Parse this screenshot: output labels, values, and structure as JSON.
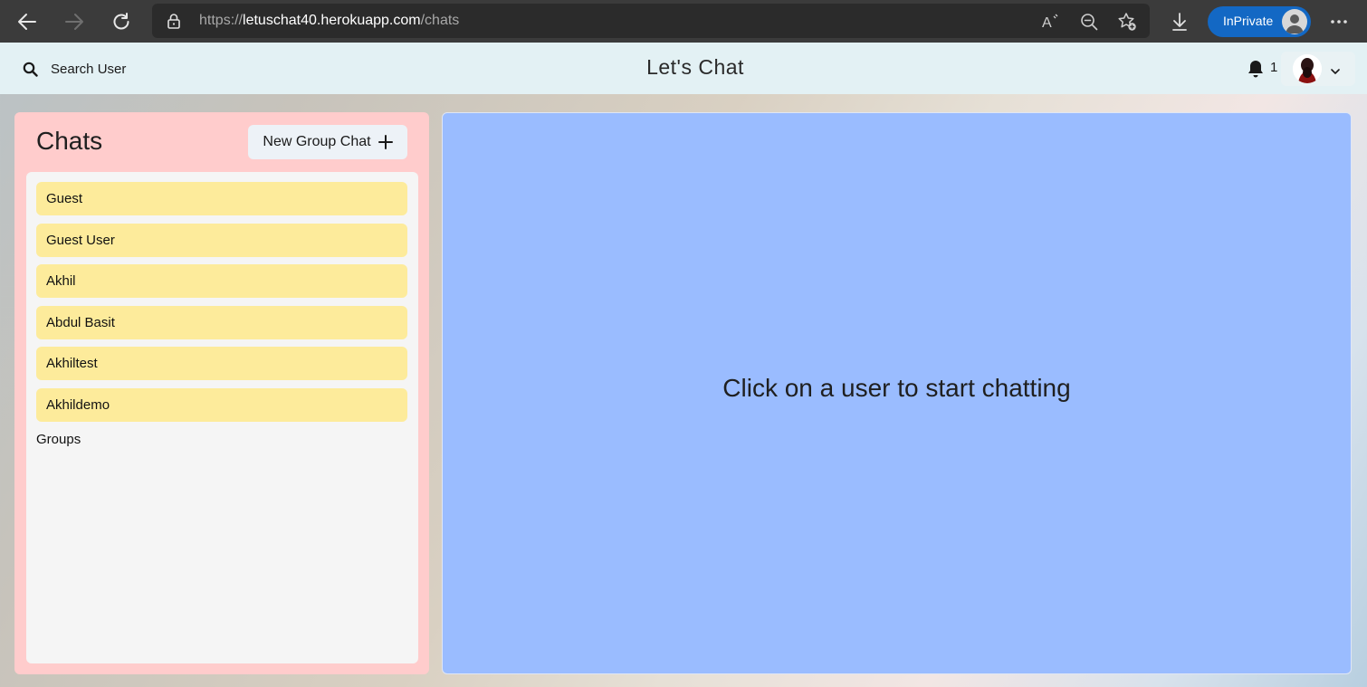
{
  "browser": {
    "url_prefix": "https://",
    "url_host": "letuschat40.herokuapp.com",
    "url_path": "/chats",
    "inprivate_label": "InPrivate",
    "icons": [
      "back-icon",
      "forward-icon",
      "refresh-icon",
      "lock-icon",
      "read-aloud-icon",
      "zoom-out-icon",
      "add-favorite-icon",
      "download-icon",
      "more-icon"
    ]
  },
  "header": {
    "search_label": "Search User",
    "title": "Let's Chat",
    "notification_count": "1"
  },
  "chats": {
    "title": "Chats",
    "new_group_label": "New Group Chat",
    "items": [
      {
        "name": "Guest"
      },
      {
        "name": "Guest User"
      },
      {
        "name": "Akhil"
      },
      {
        "name": "Abdul Basit"
      },
      {
        "name": "Akhiltest"
      },
      {
        "name": "Akhildemo"
      }
    ],
    "groups_label": "Groups"
  },
  "main": {
    "empty_message": "Click on a user to start chatting"
  },
  "colors": {
    "header_bg": "#e3f1f4",
    "chats_panel_bg": "#ffcccc",
    "chat_item_bg": "#fdeb9b",
    "chat_area_bg": "#9abcff",
    "inprivate_bg": "#1368c4"
  }
}
